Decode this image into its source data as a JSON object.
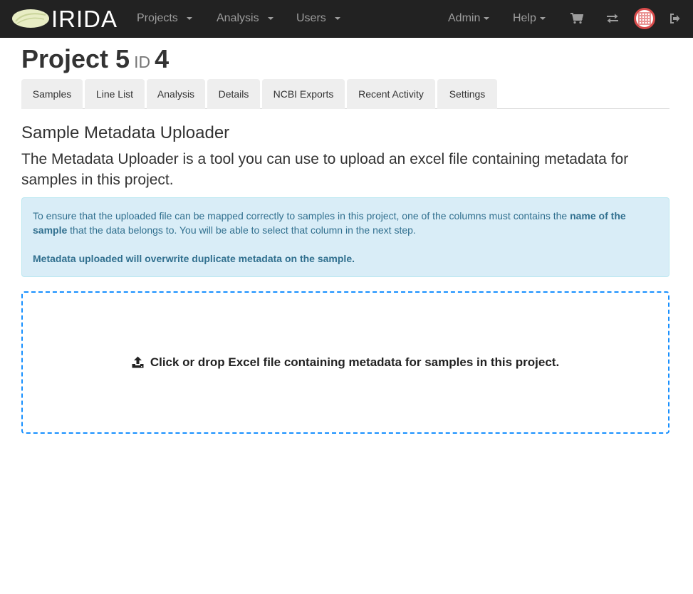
{
  "brand": {
    "name": "IRIDA"
  },
  "navbar": {
    "left_menus": [
      {
        "label": "Projects"
      },
      {
        "label": "Analysis"
      },
      {
        "label": "Users"
      }
    ],
    "right_menus": [
      {
        "label": "Admin"
      },
      {
        "label": "Help"
      }
    ],
    "icons": [
      "cart-icon",
      "transfer-icon",
      "user-avatar",
      "logout-icon"
    ]
  },
  "page": {
    "title": "Project 5",
    "id_label": "ID",
    "id_value": "4"
  },
  "tabs": [
    {
      "label": "Samples"
    },
    {
      "label": "Line List"
    },
    {
      "label": "Analysis"
    },
    {
      "label": "Details"
    },
    {
      "label": "NCBI Exports"
    },
    {
      "label": "Recent Activity"
    },
    {
      "label": "Settings"
    }
  ],
  "uploader": {
    "title": "Sample Metadata Uploader",
    "lead": "The Metadata Uploader is a tool you can use to upload an excel file containing metadata for samples in this project.",
    "alert": {
      "text_before": "To ensure that the uploaded file can be mapped correctly to samples in this project, one of the columns must contains the ",
      "text_bold": "name of the sample",
      "text_after": " that the data belongs to. You will be able to select that column in the next step.",
      "warning": "Metadata uploaded will overwrite duplicate metadata on the sample."
    },
    "dropzone_text": "Click or drop Excel file containing metadata for samples in this project."
  },
  "colors": {
    "navbar_bg": "#222222",
    "alert_bg": "#d9edf7",
    "alert_text": "#31708f",
    "dropzone_border": "#1890ff"
  }
}
